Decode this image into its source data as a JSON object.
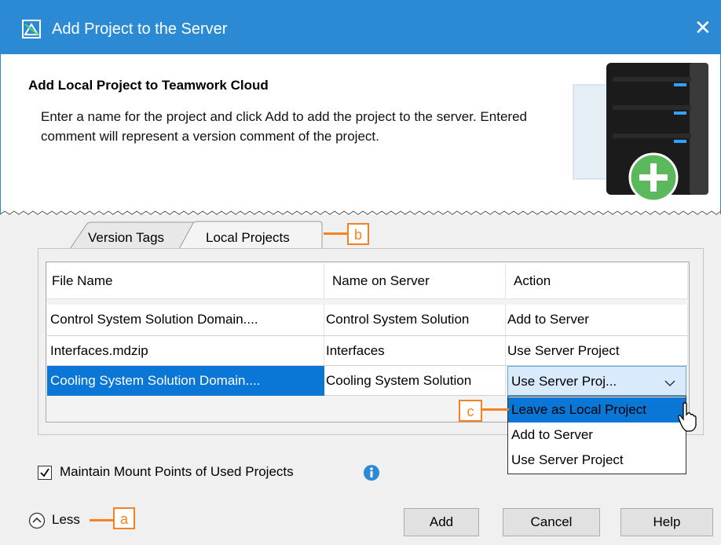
{
  "window": {
    "title": "Add Project to the Server",
    "close_glyph": "✕"
  },
  "header": {
    "title": "Add Local Project to Teamwork Cloud",
    "description": "Enter a name for the project and click Add to add the project to the server. Entered comment will represent a version comment of the project."
  },
  "tabs": [
    {
      "label": "Version Tags"
    },
    {
      "label": "Local Projects"
    }
  ],
  "table": {
    "columns": [
      "File Name",
      "Name on Server",
      "Action"
    ],
    "rows": [
      {
        "file": "Control System Solution Domain....",
        "server_name": "Control System Solution",
        "action": "Add to Server"
      },
      {
        "file": "Interfaces.mdzip",
        "server_name": "Interfaces",
        "action": "Use Server Project"
      },
      {
        "file": "Cooling System Solution Domain....",
        "server_name": "Cooling System Solution",
        "action": "Use Server Proj..."
      }
    ]
  },
  "dropdown": {
    "options": [
      "Leave as Local Project",
      "Add to Server",
      "Use Server Project"
    ]
  },
  "callouts": {
    "a": "a",
    "b": "b",
    "c": "c"
  },
  "checkbox": {
    "label": "Maintain Mount Points of Used Projects",
    "checked": true
  },
  "footer": {
    "less_label": "Less",
    "add_label": "Add",
    "cancel_label": "Cancel",
    "help_label": "Help"
  },
  "colors": {
    "titlebar": "#2b8ad3",
    "selection": "#0a76d6",
    "callout": "#f58220"
  }
}
